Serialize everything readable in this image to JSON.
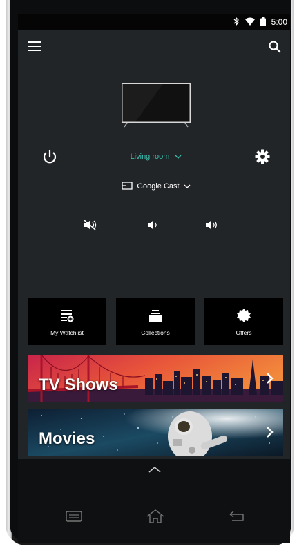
{
  "status_bar": {
    "bluetooth_icon": "bluetooth-icon",
    "wifi_icon": "wifi-icon",
    "battery_icon": "battery-icon",
    "time": "5:00"
  },
  "header": {
    "menu_icon": "hamburger-menu-icon",
    "search_icon": "search-icon"
  },
  "device": {
    "room_label": "Living room",
    "cast_label": "Google Cast"
  },
  "controls": {
    "power_icon": "power-icon",
    "settings_icon": "gear-icon",
    "mute_icon": "volume-mute-icon",
    "vol_down_icon": "volume-down-icon",
    "vol_up_icon": "volume-up-icon"
  },
  "tiles": [
    {
      "label": "My Watchlist",
      "icon": "watchlist-icon"
    },
    {
      "label": "Collections",
      "icon": "collections-icon"
    },
    {
      "label": "Offers",
      "icon": "offers-icon"
    }
  ],
  "banners": [
    {
      "label": "TV Shows"
    },
    {
      "label": "Movies"
    }
  ],
  "colors": {
    "background": "#222528",
    "accent": "#3bbfae",
    "tile": "#000000"
  }
}
